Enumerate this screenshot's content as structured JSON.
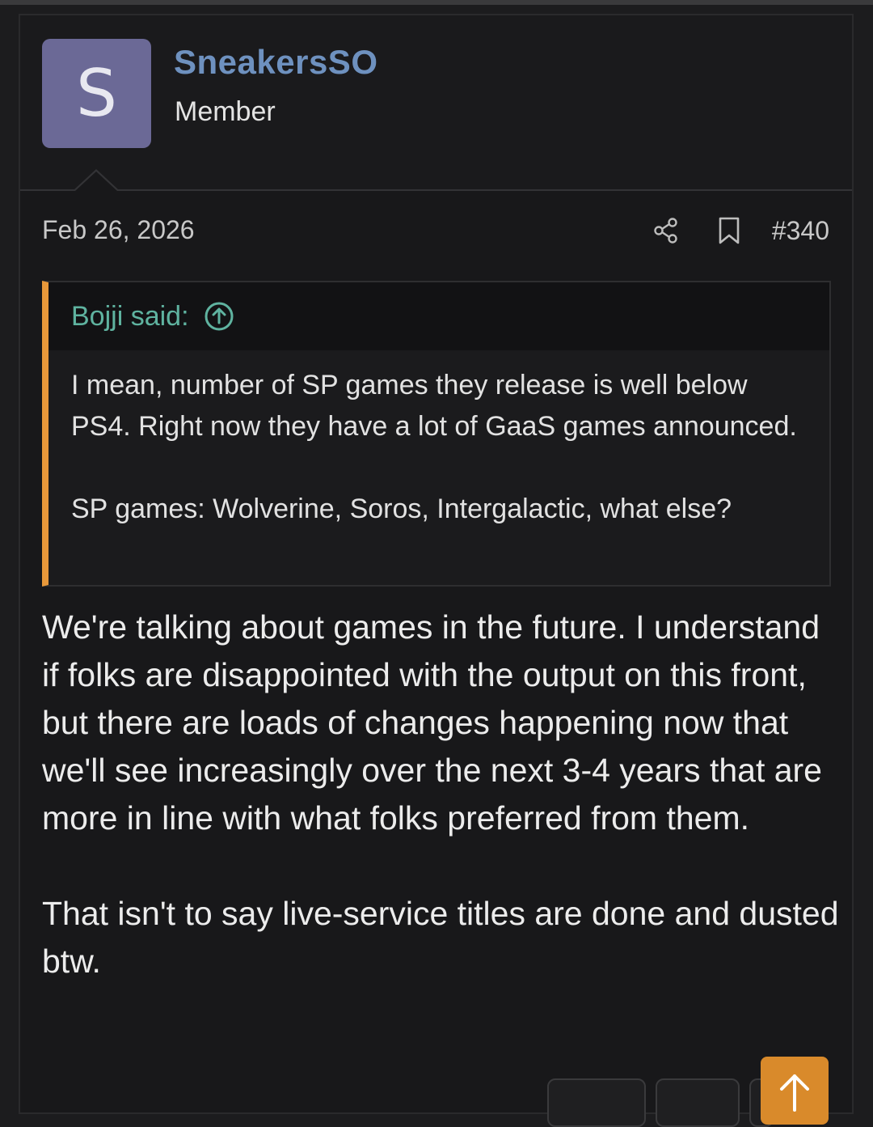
{
  "post": {
    "author": {
      "avatar_letter": "S",
      "username": "SneakersSO",
      "title": "Member"
    },
    "date": "Feb 26, 2026",
    "post_number": "#340",
    "actions": {
      "share_icon": "share-icon",
      "bookmark_icon": "bookmark-icon"
    },
    "quote": {
      "author_label": "Bojji said:",
      "jump_icon": "arrow-up-circle-icon",
      "paragraphs": [
        "I mean, number of SP games they release is well below PS4. Right now they have a lot of GaaS games announced.",
        "SP games: Wolverine, Soros, Intergalactic, what else?"
      ]
    },
    "message": {
      "paragraphs": [
        "We're talking about games in the future. I understand if folks are disappointed with the output on this front, but there are loads of changes happening now that we'll see increasingly over the next 3-4 years that are more in line with what folks preferred from them.",
        "That isn't to say live-service titles are done and dusted btw."
      ]
    },
    "scroll_top_icon": "arrow-up-icon"
  },
  "colors": {
    "background": "#18181a",
    "username": "#6e91bf",
    "avatar": "#6b6996",
    "quote_accent": "#e8983a",
    "quote_author": "#5fb3a0",
    "scroll_button": "#d98a2b"
  }
}
